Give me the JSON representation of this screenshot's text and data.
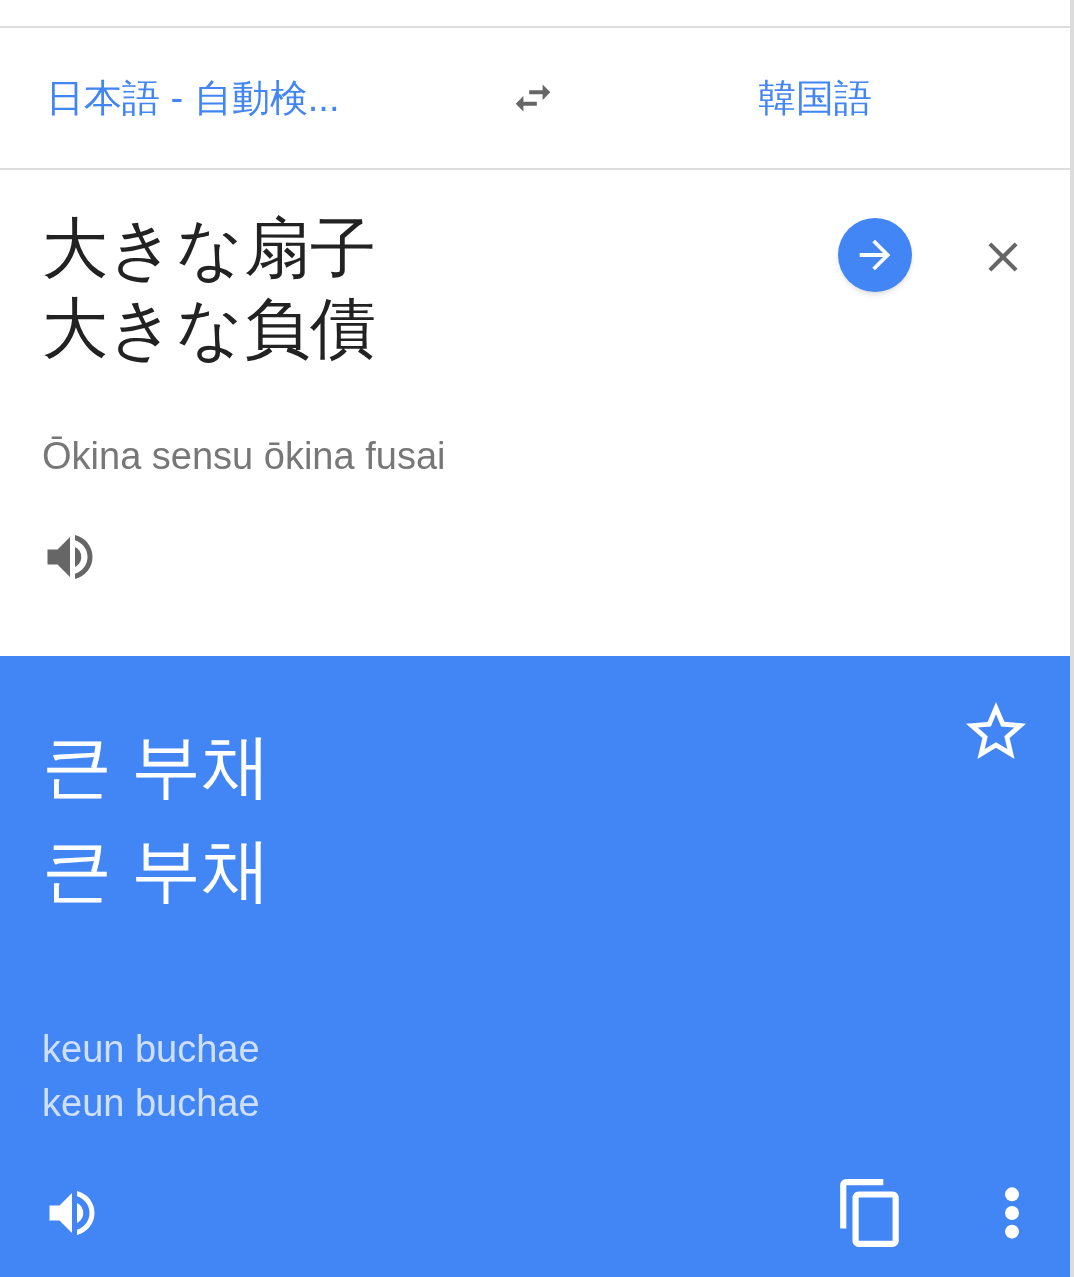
{
  "languages": {
    "source": "日本語 - 自動検...",
    "target": "韓国語"
  },
  "input": {
    "lines": [
      "大きな扇子",
      "大きな負債"
    ],
    "romanization": "Ōkina sensu ōkina fusai"
  },
  "output": {
    "lines": [
      "큰 부채",
      "큰 부채"
    ],
    "romanization": [
      "keun buchae",
      "keun buchae"
    ],
    "starred": false
  }
}
